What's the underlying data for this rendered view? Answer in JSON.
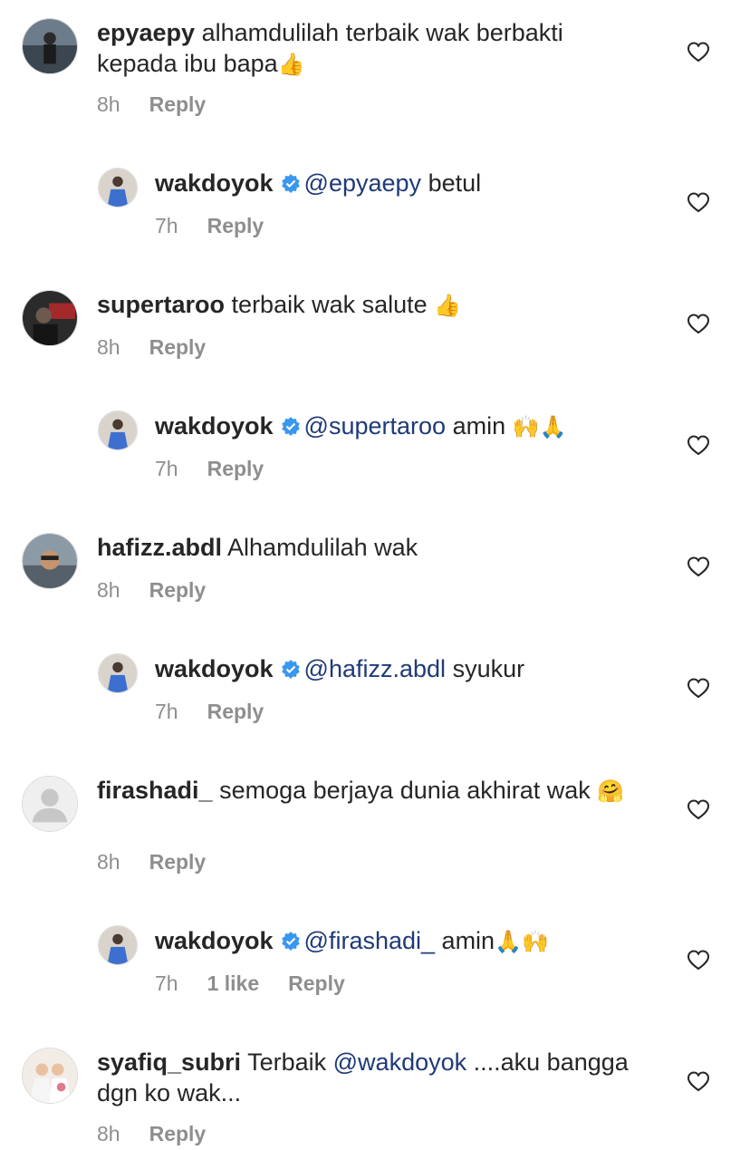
{
  "comments": [
    {
      "username": "epyaepy",
      "text": "alhamdulilah terbaik wak berbakti kepada ibu bapa",
      "emoji": "👍",
      "time": "8h",
      "reply": "Reply"
    },
    {
      "username": "wakdoyok",
      "mention": "@epyaepy",
      "text": "betul",
      "time": "7h",
      "reply": "Reply"
    },
    {
      "username": "supertaroo",
      "text": "terbaik wak salute",
      "emoji": "👍",
      "time": "8h",
      "reply": "Reply"
    },
    {
      "username": "wakdoyok",
      "mention": "@supertaroo",
      "text": "amin",
      "emoji": "🙌🙏",
      "time": "7h",
      "reply": "Reply"
    },
    {
      "username": "hafizz.abdl",
      "text": "Alhamdulilah wak",
      "time": "8h",
      "reply": "Reply"
    },
    {
      "username": "wakdoyok",
      "mention": "@hafizz.abdl",
      "text": "syukur",
      "time": "7h",
      "reply": "Reply"
    },
    {
      "username": "firashadi_",
      "text": "semoga berjaya dunia akhirat wak",
      "emoji": "🤗",
      "time": "8h",
      "reply": "Reply"
    },
    {
      "username": "wakdoyok",
      "mention": "@firashadi_",
      "text": "amin",
      "emoji": "🙏🙌",
      "time": "7h",
      "likes": "1 like",
      "reply": "Reply"
    },
    {
      "username": "syafiq_subri",
      "text_before": "Terbaik",
      "mention": "@wakdoyok",
      "text": "....aku bangga dgn ko wak...",
      "time": "8h",
      "reply": "Reply"
    }
  ],
  "colors": {
    "text": "#262626",
    "meta": "#8e8e8e",
    "mention": "#1e3a78",
    "verified": "#3897f0"
  },
  "icons": {
    "like": "heart-outline-icon",
    "verified": "verified-badge-icon"
  }
}
